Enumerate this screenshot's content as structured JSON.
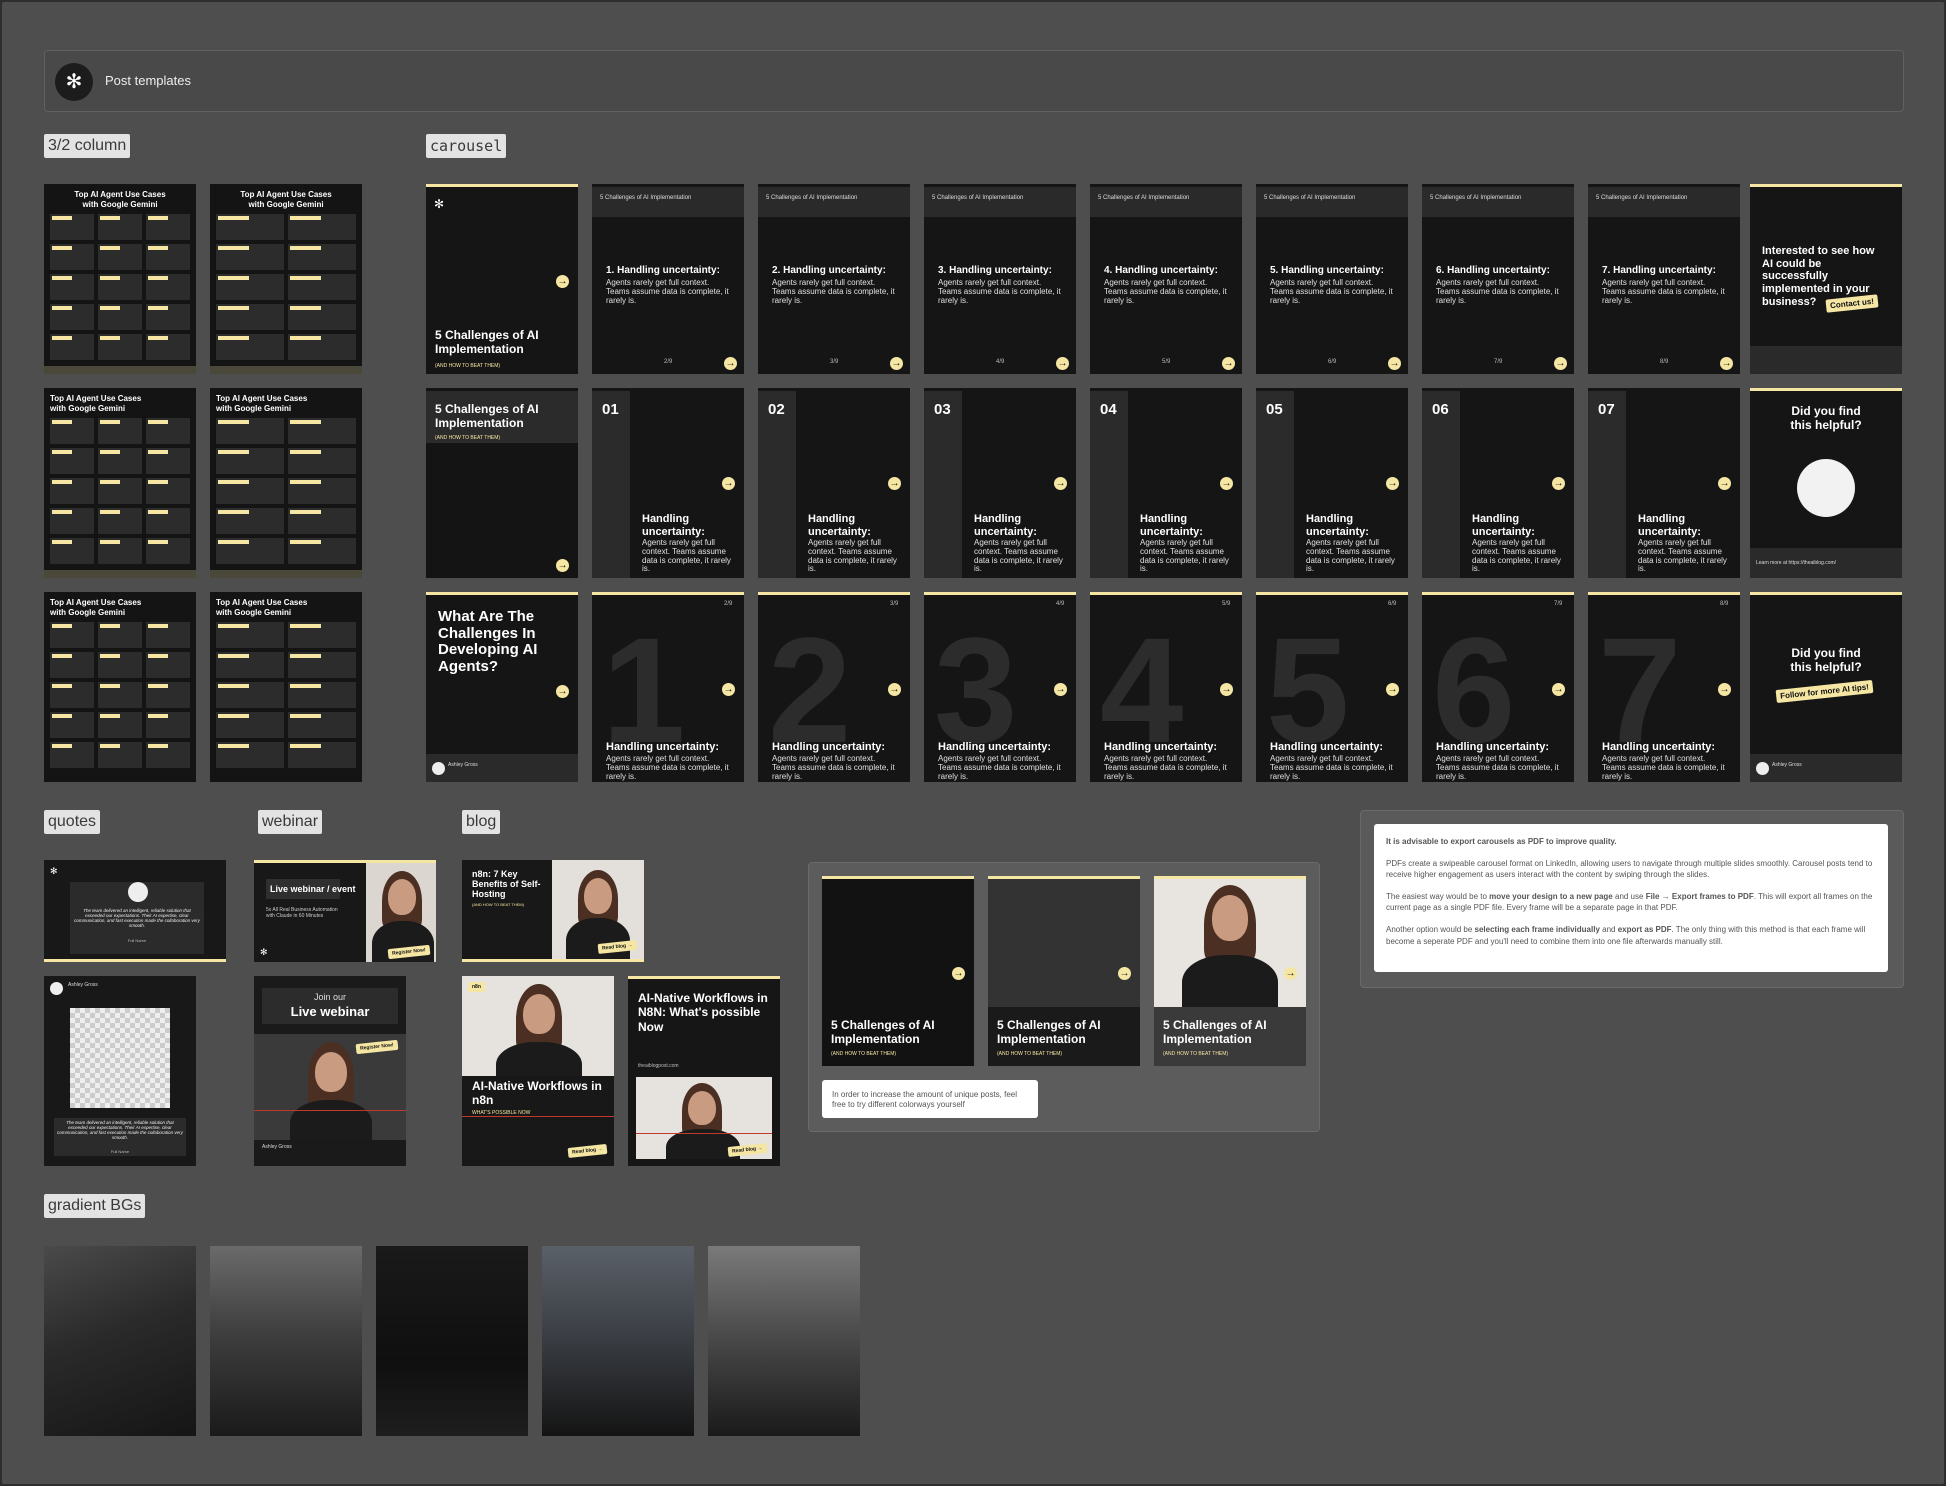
{
  "header": {
    "title": "Post templates",
    "logo_glyph": "✻"
  },
  "sections": {
    "column": "3/2 column",
    "carousel": "carousel",
    "quotes": "quotes",
    "webinar": "webinar",
    "blog": "blog",
    "gradient": "gradient BGs"
  },
  "column_templates": {
    "title_line1": "Top AI Agent Use Cases",
    "title_line2": "with Google Gemini"
  },
  "carousel": {
    "cover_title": "5 Challenges of AI Implementation",
    "cover_sub": "(AND HOW TO BEAT THEM)",
    "topbar_title": "5 Challenges of AI Implementation",
    "slide_body": "Agents rarely get full context. Teams assume data is complete, it rarely is.",
    "row1_titles": [
      "1. Handling uncertainty:",
      "2. Handling uncertainty:",
      "3. Handling uncertainty:",
      "4. Handling uncertainty:",
      "5. Handling uncertainty:",
      "6. Handling uncertainty:",
      "7. Handling uncertainty:"
    ],
    "row1_pages": [
      "2/9",
      "3/9",
      "4/9",
      "5/9",
      "6/9",
      "7/9",
      "8/9"
    ],
    "row1_end_title": "Interested to see how AI could be successfully implemented in your business?",
    "row1_end_badge": "Contact us!",
    "row2_numbers": [
      "01",
      "02",
      "03",
      "04",
      "05",
      "06",
      "07"
    ],
    "row2_title": "Handling uncertainty:",
    "row2_end_title": "Did you find this helpful?",
    "row2_end_link": "Learn more at https://theaiblog.com/",
    "row3_cover_title": "What Are The Challenges In Developing AI Agents?",
    "row3_digits": [
      "1",
      "2",
      "3",
      "4",
      "5",
      "6",
      "7"
    ],
    "row3_pages": [
      "2/9",
      "3/9",
      "4/9",
      "5/9",
      "6/9",
      "7/9",
      "8/9"
    ],
    "row3_title": "Handling uncertainty:",
    "row3_end_title": "Did you find this helpful?",
    "row3_end_badge": "Follow for more AI tips!",
    "author": "Ashley Gross"
  },
  "quotes": {
    "quote_text": "The team delivered an intelligent, reliable solution that exceeded our expectations. Their AI expertise, clear communication, and fast execution made the collaboration very smooth.",
    "author": "Full Name",
    "author_role": "Company",
    "profile_name": "Ashley Gross"
  },
  "webinar": {
    "card1_title": "Live webinar / event",
    "card1_body": "5x All Real Business Automation with Claude in 60 Minutes",
    "card1_badge": "Register Now!",
    "card2_pre": "Join our",
    "card2_title": "Live webinar",
    "card2_badge": "Register Now!",
    "card2_author": "Ashley Gross"
  },
  "blog": {
    "card1_title": "n8n: 7 Key Benefits of Self-Hosting",
    "card1_sub": "(AND HOW TO BEAT THEM)",
    "card1_badge": "Read blog →",
    "card2_tag": "n8n",
    "card2_title": "AI-Native Workflows in n8n",
    "card2_sub": "WHAT'S POSSIBLE NOW",
    "card2_badge": "Read blog →",
    "card3_title": "AI-Native Workflows in N8N: What's possible Now",
    "card3_url": "theaiblogpost.com",
    "card3_badge": "Read blog →"
  },
  "colorways": {
    "title": "5 Challenges of AI Implementation",
    "sub": "(AND HOW TO BEAT THEM)",
    "note": "In order to increase the amount of unique posts, feel free to try different colorways yourself"
  },
  "export_note": {
    "p1": "It is advisable to export carousels as PDF to improve quality.",
    "p2": "PDFs create a swipeable carousel format on LinkedIn, allowing users to navigate through multiple slides smoothly. Carousel posts tend to receive higher engagement as users interact with the content by swiping through the slides.",
    "p3a": "The easiest way would be to ",
    "p3b": "move your design to a new page",
    "p3c": " and use ",
    "p3d": "File → Export frames to PDF",
    "p3e": ". This will export all frames on the current page as a single PDF file. Every frame will be a separate page in that PDF.",
    "p4a": "Another option would be ",
    "p4b": "selecting each frame individually",
    "p4c": " and ",
    "p4d": "export as PDF",
    "p4e": ". The only thing with this method is that each frame will become a seperate PDF and you'll need to combine them into one file afterwards manually still."
  },
  "colors": {
    "accent": "#f5e6a3",
    "canvas": "#4e4e4e",
    "card": "#151515"
  }
}
